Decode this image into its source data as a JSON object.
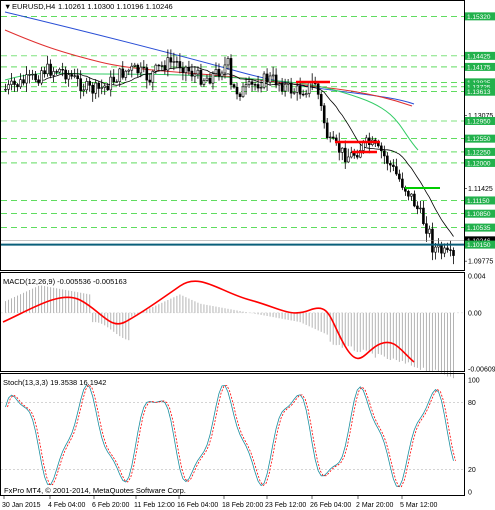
{
  "colors": {
    "background": "#ffffff",
    "candles": "#000000",
    "grid_green": "#00c800",
    "ma_blue": "#2a4fd6",
    "ma_red": "#e03030",
    "ma_green": "#33cc66",
    "ma_black": "#000000",
    "level_red": "#ff0000",
    "level_green": "#00cc00",
    "bid_line": "#0a5f7a",
    "price_tag": "#22b14c",
    "macd_signal": "#ff0000",
    "macd_hist": "#b4b4b4",
    "stoch_main": "#1a8fa0",
    "stoch_signal": "#ff0000"
  },
  "header": {
    "symbol": "EURUSD,H4",
    "ohlc": "1.10261 1.10300 1.10196 1.10246"
  },
  "price_axis": {
    "labels": [
      "1.15320",
      "1.14425",
      "1.14175",
      "1.13825",
      "1.13725",
      "1.13613",
      "1.13075",
      "1.12950",
      "1.12550",
      "1.12250",
      "1.12000",
      "1.11425",
      "1.11150",
      "1.10850",
      "1.10535",
      "1.10246",
      "1.10150",
      "1.09775"
    ],
    "highlighted": [
      "1.15320",
      "1.14425",
      "1.14175",
      "1.13825",
      "1.13725",
      "1.13613",
      "1.12950",
      "1.12550",
      "1.12250",
      "1.12000",
      "1.11150",
      "1.10850",
      "1.10535",
      "1.10246",
      "1.10150"
    ]
  },
  "macd": {
    "label": "MACD(12,26,9) -0.005536 -0.005163",
    "axis_labels": [
      "0.004",
      "0.00",
      "-0.006091"
    ]
  },
  "stoch": {
    "label": "Stoch(13,3,3) 19.3538 16.1942",
    "axis_labels": [
      "100",
      "80",
      "20",
      "0"
    ]
  },
  "time_axis": [
    "30 Jan 2015",
    "4 Feb 04:00",
    "6 Feb 20:00",
    "11 Feb 12:00",
    "16 Feb 04:00",
    "18 Feb 20:00",
    "23 Feb 12:00",
    "26 Feb 04:00",
    "2 Mar 20:00",
    "5 Mar 12:00"
  ],
  "copyright": "FxPro MT4, © 2001-2014, MetaQuotes Software Corp."
}
